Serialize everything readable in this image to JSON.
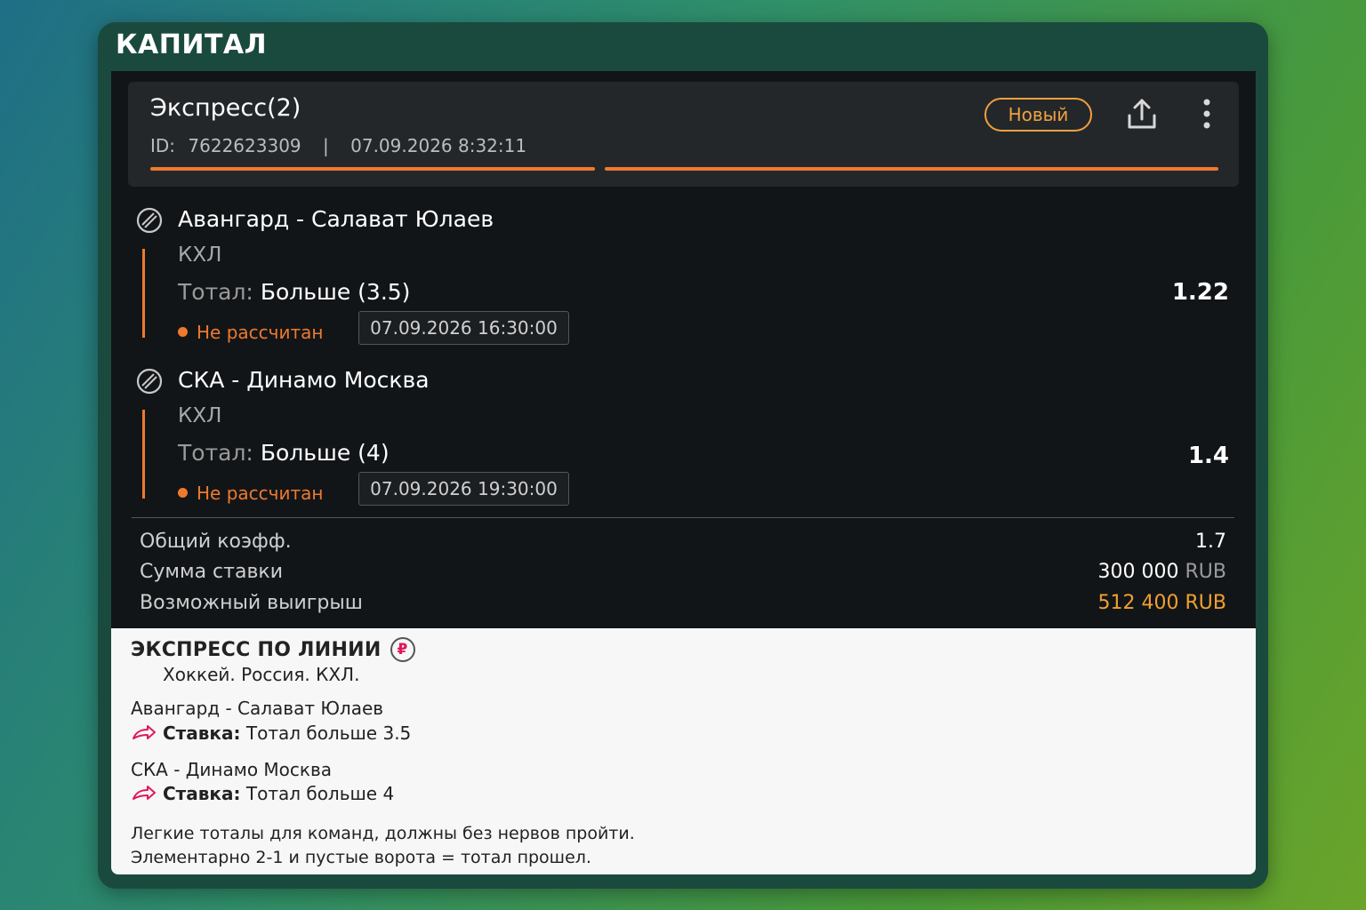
{
  "brand": "КАПИТАЛ",
  "ticket": {
    "title": "Экспресс(2)",
    "id_label": "ID:",
    "id_value": "7622623309",
    "separator": "|",
    "datetime": "07.09.2026 8:32:11",
    "status_badge": "Новый",
    "share_icon": "share-icon",
    "more_icon": "more-vertical-icon"
  },
  "events": [
    {
      "name": "Авангард - Салават Юлаев",
      "league": "КХЛ",
      "bet_label": "Тотал:",
      "bet_value": "Больше (3.5)",
      "odd": "1.22",
      "status": "Не рассчитан",
      "start": "07.09.2026 16:30:00",
      "icon": "hockey-puck-icon"
    },
    {
      "name": "СКА - Динамо Москва",
      "league": "КХЛ",
      "bet_label": "Тотал:",
      "bet_value": "Больше (4)",
      "odd": "1.4",
      "status": "Не рассчитан",
      "start": "07.09.2026 19:30:00",
      "icon": "hockey-puck-icon"
    }
  ],
  "summary": {
    "total_odd_label": "Общий коэфф.",
    "total_odd_value": "1.7",
    "stake_label": "Сумма ставки",
    "stake_value": "300 000",
    "stake_currency": "RUB",
    "win_label": "Возможный выигрыш",
    "win_value": "512 400 RUB"
  },
  "note": {
    "title": "ЭКСПРЕСС ПО ЛИНИИ",
    "rub_symbol": "₽",
    "subtitle": "Хоккей. Россия. КХЛ.",
    "picks": [
      {
        "match": "Авангард - Салават Юлаев",
        "bet_label": "Ставка:",
        "bet_text": "Тотал больше 3.5"
      },
      {
        "match": "СКА - Динамо Москва",
        "bet_label": "Ставка:",
        "bet_text": "Тотал больше 4"
      }
    ],
    "comment_1": "Легкие тоталы для команд, должны без нервов пройти.",
    "comment_2": "Элементарно 2-1 и пустые ворота = тотал прошел."
  },
  "colors": {
    "accent_orange": "#ee7a2e",
    "win_gold": "#f0a030",
    "arrow_pink": "#e0195a"
  }
}
